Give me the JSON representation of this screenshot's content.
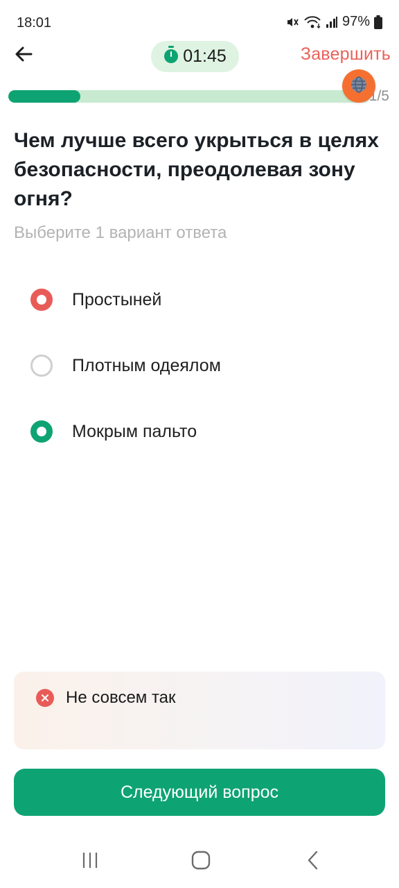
{
  "status_bar": {
    "time": "18:01",
    "battery": "97%",
    "icons": [
      "mute-icon",
      "wifi-icon",
      "signal-icon",
      "battery-icon"
    ]
  },
  "header": {
    "back_icon": "arrow-left-icon",
    "timer": "01:45",
    "timer_icon": "stopwatch-icon",
    "finish_label": "Завершить"
  },
  "progress": {
    "current_fraction": 0.2,
    "count_text": "1/5",
    "badge_icon": "globe-icon"
  },
  "question": {
    "text": "Чем лучше всего укрыться в целях безопасности, преодолевая зону огня?",
    "hint": "Выберите 1 вариант ответа"
  },
  "options": [
    {
      "label": "Простыней",
      "state": "wrong"
    },
    {
      "label": "Плотным одеялом",
      "state": "unselected"
    },
    {
      "label": "Мокрым пальто",
      "state": "correct"
    }
  ],
  "feedback": {
    "text": "Не совсем так",
    "icon": "close-circle-icon"
  },
  "next_button": {
    "label": "Следующий вопрос"
  },
  "nav_bar": {
    "icons": [
      "recent-apps-icon",
      "home-icon",
      "back-icon"
    ]
  },
  "colors": {
    "accent": "#0ea372",
    "error": "#e85c58",
    "timer_bg": "#dff3e2",
    "progress_track": "#c7ead0",
    "badge": "#f57030"
  }
}
